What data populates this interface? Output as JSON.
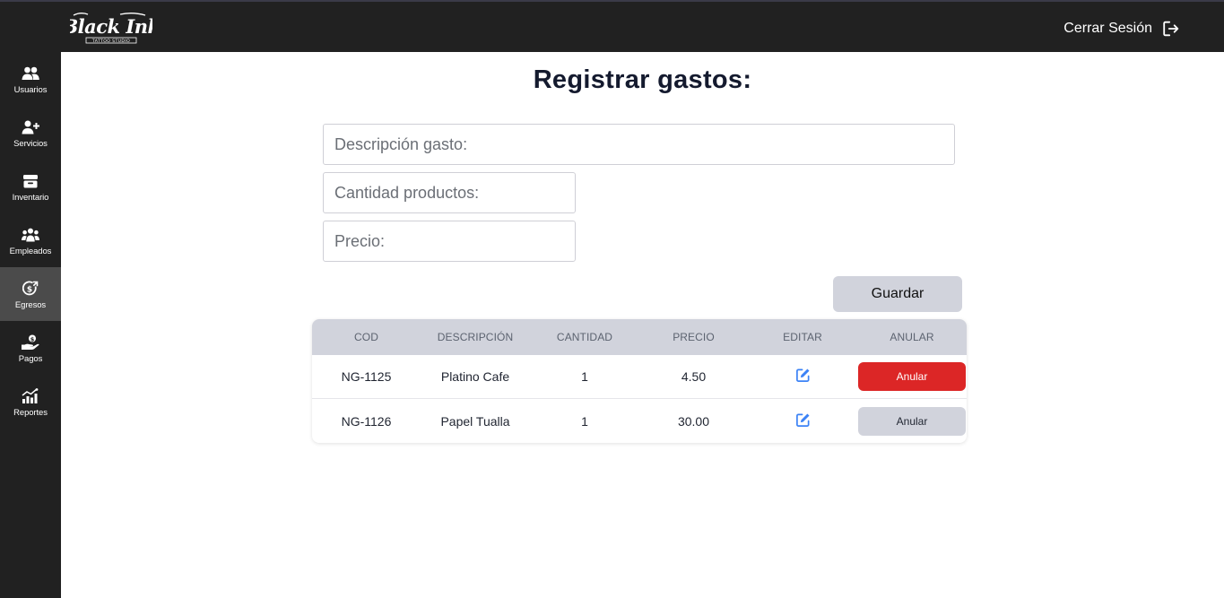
{
  "brand": {
    "logo_text": "Black Ink",
    "logo_subtext": "TATTOO STUDIO"
  },
  "header": {
    "logout_label": "Cerrar Sesión"
  },
  "sidebar": {
    "items": [
      {
        "label": "Usuarios",
        "icon": "users-icon"
      },
      {
        "label": "Servicios",
        "icon": "user-plus-icon"
      },
      {
        "label": "Inventario",
        "icon": "box-icon"
      },
      {
        "label": "Empleados",
        "icon": "people-group-icon"
      },
      {
        "label": "Egresos",
        "icon": "money-out-icon",
        "active": true
      },
      {
        "label": "Pagos",
        "icon": "hand-coin-icon"
      },
      {
        "label": "Reportes",
        "icon": "chart-icon"
      }
    ]
  },
  "main": {
    "title": "Registrar gastos:",
    "form": {
      "description_placeholder": "Descripción gasto:",
      "quantity_placeholder": "Cantidad productos:",
      "price_placeholder": "Precio:",
      "save_label": "Guardar"
    },
    "table": {
      "headers": [
        "COD",
        "DESCRIPCIÓN",
        "CANTIDAD",
        "PRECIO",
        "EDITAR",
        "ANULAR"
      ],
      "rows": [
        {
          "cod": "NG-1125",
          "descripcion": "Platino Cafe",
          "cantidad": "1",
          "precio": "4.50",
          "anular_label": "Anular",
          "anular_style": "danger"
        },
        {
          "cod": "NG-1126",
          "descripcion": "Papel Tualla",
          "cantidad": "1",
          "precio": "30.00",
          "anular_label": "Anular",
          "anular_style": "neutral"
        }
      ]
    }
  },
  "colors": {
    "topbar": "#212121",
    "sidebar_active": "#4b4b4b",
    "danger": "#dc2626",
    "neutral_button": "#d1d3dc",
    "edit_icon": "#3b82f6"
  }
}
